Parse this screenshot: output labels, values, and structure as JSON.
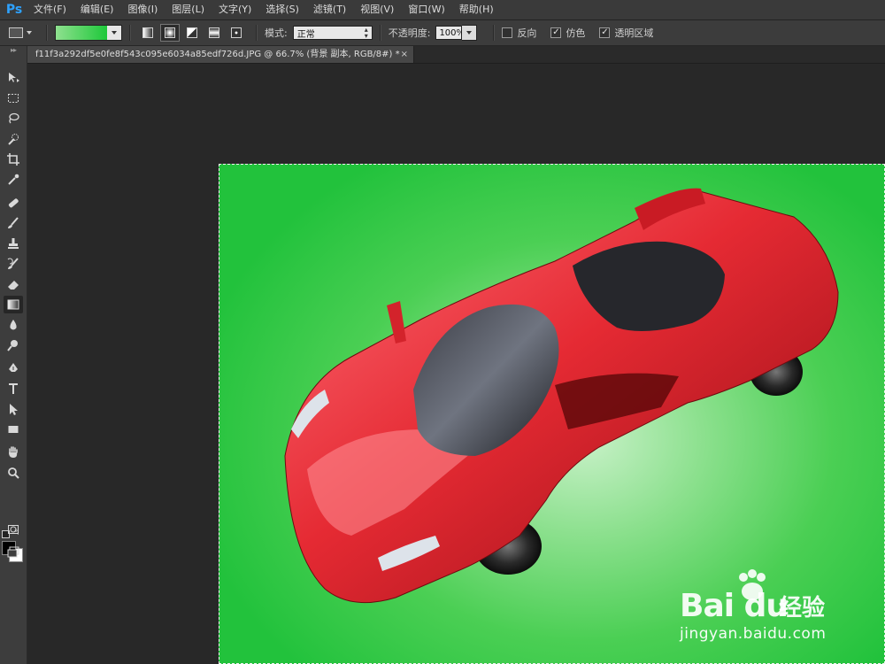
{
  "app": {
    "logo": "Ps"
  },
  "menu": [
    "文件(F)",
    "编辑(E)",
    "图像(I)",
    "图层(L)",
    "文字(Y)",
    "选择(S)",
    "滤镜(T)",
    "视图(V)",
    "窗口(W)",
    "帮助(H)"
  ],
  "options": {
    "gradient_colors": [
      "#8fe08f",
      "#1ec83a"
    ],
    "mode_label": "模式:",
    "mode_value": "正常",
    "opacity_label": "不透明度:",
    "opacity_value": "100%",
    "reverse_label": "反向",
    "reverse_checked": false,
    "dither_label": "仿色",
    "dither_checked": true,
    "transparency_label": "透明区域",
    "transparency_checked": true
  },
  "document": {
    "tab_title": "f11f3a292df5e0fe8f543c095e6034a85edf726d.JPG @ 66.7% (背景 副本, RGB/8#) *",
    "close_glyph": "×"
  },
  "toolbox": {
    "active_tool": "gradient-tool",
    "foreground_color": "#000000",
    "background_color": "#ffffff"
  },
  "canvas": {
    "background_colors": [
      "#c8f1c8",
      "#22c23c"
    ],
    "car_color": "#d81f26"
  },
  "watermark": {
    "brand": "Bai du",
    "cn": "经验",
    "url": "jingyan.baidu.com"
  }
}
